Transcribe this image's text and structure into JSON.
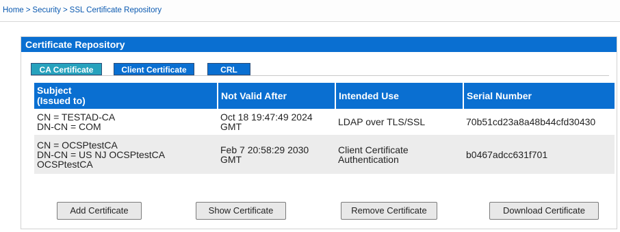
{
  "breadcrumb": {
    "items": [
      "Home",
      "Security",
      "SSL Certificate Repository"
    ],
    "separator": ">"
  },
  "panel": {
    "title": "Certificate Repository"
  },
  "tabs": [
    {
      "label": "CA Certificate",
      "active": true
    },
    {
      "label": "Client Certificate",
      "active": false
    },
    {
      "label": "CRL",
      "active": false
    }
  ],
  "table": {
    "headers": [
      [
        "Subject",
        "(Issued to)"
      ],
      [
        "Not Valid After"
      ],
      [
        "Intended Use"
      ],
      [
        "Serial Number"
      ]
    ],
    "rows": [
      {
        "subject": [
          "CN = TESTAD-CA",
          "DN-CN = COM"
        ],
        "not_valid_after": [
          "Oct 18 19:47:49 2024",
          "GMT"
        ],
        "intended_use": [
          "LDAP over TLS/SSL"
        ],
        "serial_number": "70b51cd23a8a48b44cfd30430"
      },
      {
        "subject": [
          "CN = OCSPtestCA",
          "DN-CN = US NJ OCSPtestCA",
          "OCSPtestCA"
        ],
        "not_valid_after": [
          "Feb 7 20:58:29 2030",
          "GMT"
        ],
        "intended_use": [
          "Client Certificate",
          "Authentication"
        ],
        "serial_number": "b0467adcc631f701"
      }
    ]
  },
  "buttons": {
    "add": "Add Certificate",
    "show": "Show Certificate",
    "remove": "Remove Certificate",
    "download": "Download Certificate"
  },
  "colors": {
    "header_blue": "#0a6fd1",
    "active_tab": "#27a2bd",
    "link": "#0a59b0",
    "alt_row": "#ececec"
  }
}
